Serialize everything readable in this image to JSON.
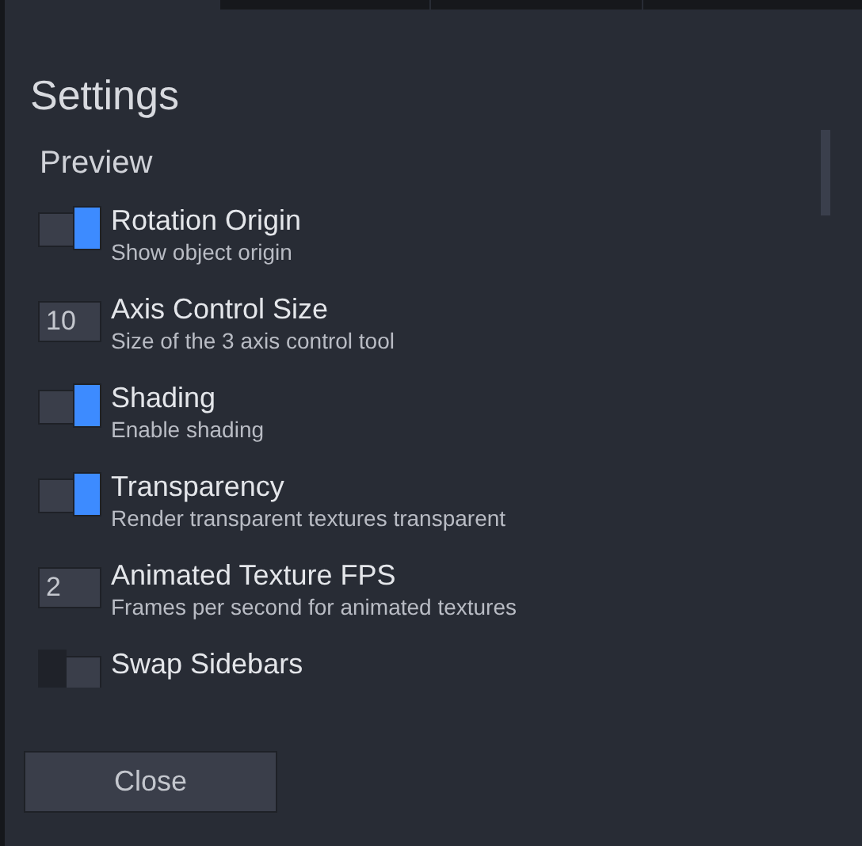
{
  "title": "Settings",
  "section": "Preview",
  "settings": [
    {
      "kind": "toggle",
      "title": "Rotation Origin",
      "description": "Show object origin",
      "on": true
    },
    {
      "kind": "number",
      "title": "Axis Control Size",
      "description": "Size of the 3 axis control tool",
      "value": "10"
    },
    {
      "kind": "toggle",
      "title": "Shading",
      "description": "Enable shading",
      "on": true
    },
    {
      "kind": "toggle",
      "title": "Transparency",
      "description": "Render transparent textures transparent",
      "on": true
    },
    {
      "kind": "number",
      "title": "Animated Texture FPS",
      "description": "Frames per second for animated textures",
      "value": "2"
    },
    {
      "kind": "toggle",
      "title": "Swap Sidebars",
      "on": false
    }
  ],
  "close_button": "Close"
}
